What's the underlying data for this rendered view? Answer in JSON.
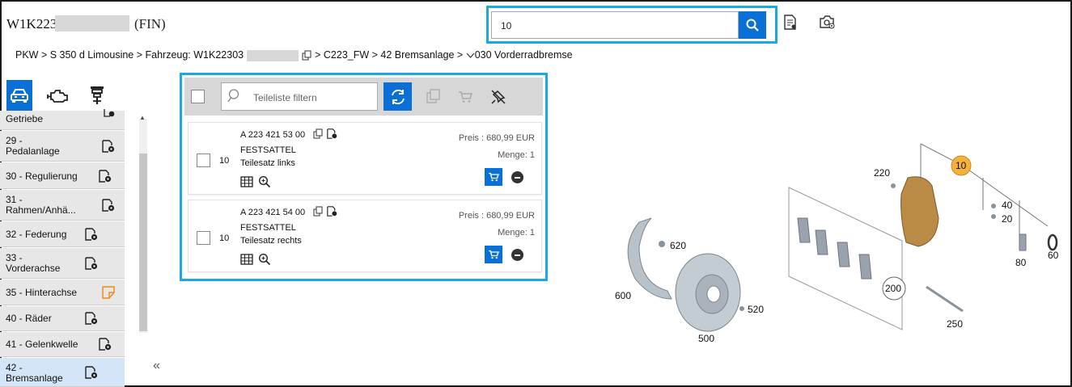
{
  "header": {
    "vin_prefix": "W1K223",
    "vin_suffix": "(FIN)",
    "search_value": "10"
  },
  "breadcrumb": {
    "part1": "PKW > S 350 d Limousine > Fahrzeug: W1K22303",
    "part2": "> C223_FW > 42 Bremsanlage >",
    "part3": "030 Vorderradbremse"
  },
  "sidebar": {
    "items": [
      {
        "label": "Getriebe"
      },
      {
        "label": "29 -",
        "label2": "Pedalanlage"
      },
      {
        "label": "30 - Regulierung"
      },
      {
        "label": "31 -",
        "label2": "Rahmen/Anhä..."
      },
      {
        "label": "32 - Federung"
      },
      {
        "label": "33 -",
        "label2": "Vorderachse"
      },
      {
        "label": "35 - Hinterachse"
      },
      {
        "label": "40 - Räder"
      },
      {
        "label": "41 - Gelenkwelle"
      },
      {
        "label": "42 -",
        "label2": "Bremsanlage"
      }
    ],
    "collapse": "«"
  },
  "parts_panel": {
    "filter_placeholder": "Teileliste filtern",
    "parts": [
      {
        "position": "10",
        "number": "A 223 421 53 00",
        "name": "FESTSATTEL",
        "description": "Teilesatz links",
        "price": "Preis : 680,99 EUR",
        "quantity": "Menge: 1"
      },
      {
        "position": "10",
        "number": "A 223 421 54 00",
        "name": "FESTSATTEL",
        "description": "Teilesatz rechts",
        "price": "Preis : 680,99 EUR",
        "quantity": "Menge: 1"
      }
    ]
  },
  "diagram": {
    "callouts": {
      "c10": "10",
      "c220": "220",
      "c40": "40",
      "c20": "20",
      "c80": "80",
      "c60": "60",
      "c620": "620",
      "c600": "600",
      "c200": "200",
      "c520": "520",
      "c500": "500",
      "c250": "250"
    }
  },
  "colors": {
    "accent": "#0a6fd6",
    "highlight": "#1ea7e6",
    "callout_orange": "#f4b23a"
  }
}
